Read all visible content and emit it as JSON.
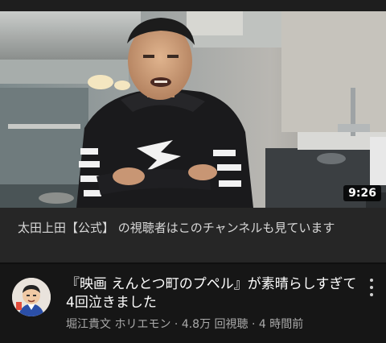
{
  "video": {
    "duration": "9:26",
    "title": "『映画 えんとつ町のプペル』が素晴らしすぎて4回泣きました",
    "channel": "堀江貴文 ホリエモン",
    "views": "4.8万 回視聴",
    "age": "4 時間前",
    "separator": " · "
  },
  "info_banner": {
    "text": "太田上田【公式】 の視聴者はこのチャンネルも見ています"
  },
  "icons": {
    "menu": "more-vert-icon"
  },
  "colors": {
    "background": "#0f0f0f",
    "banner": "#262626",
    "meta_text": "#aaaaaa"
  }
}
